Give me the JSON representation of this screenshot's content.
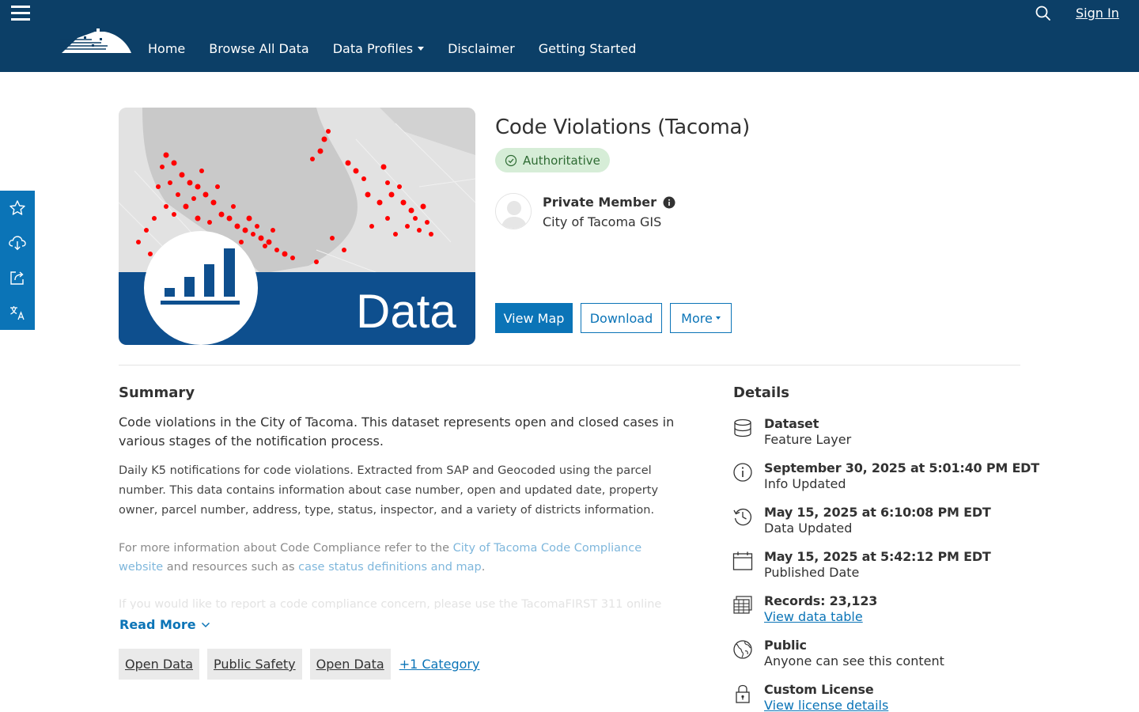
{
  "header": {
    "nav": [
      {
        "label": "Home"
      },
      {
        "label": "Browse All Data"
      },
      {
        "label": "Data Profiles"
      },
      {
        "label": "Disclaimer"
      },
      {
        "label": "Getting Started"
      }
    ],
    "sign_in": "Sign In"
  },
  "thumbnail": {
    "overlay_text": "Data"
  },
  "item": {
    "title": "Code Violations (Tacoma)",
    "badge": "Authoritative",
    "owner_name": "Private Member",
    "owner_org": "City of Tacoma GIS",
    "buttons": {
      "view_map": "View Map",
      "download": "Download",
      "more": "More"
    }
  },
  "summary": {
    "heading": "Summary",
    "lead": "Code violations in the City of Tacoma. This dataset represents open and closed cases in various stages of the notification process.",
    "desc_1": "Daily K5 notifications for code violations.  Extracted from SAP and Geocoded using the parcel number. This data contains information about case number, open and updated date, property owner, parcel number, address, type, status, inspector, and a variety of districts information.",
    "desc_2_prefix": "For more information about Code Compliance refer to the ",
    "desc_2_link1": "City of Tacoma Code Compliance website",
    "desc_2_mid": " and resources such as ",
    "desc_2_link2": "case status definitions and map",
    "desc_2_suffix": ".",
    "desc_3": "If you would like to report a code compliance concern, please use the TacomaFIRST 311 online",
    "read_more": "Read More",
    "tags": [
      "Open Data",
      "Public Safety",
      "Open Data"
    ],
    "more_categories": "+1 Category"
  },
  "details": {
    "heading": "Details",
    "items": [
      {
        "icon": "database-icon",
        "title": "Dataset",
        "sub": "Feature Layer"
      },
      {
        "icon": "info-icon",
        "title": "September 30, 2025 at 5:01:40 PM EDT",
        "sub": "Info Updated"
      },
      {
        "icon": "history-icon",
        "title": "May 15, 2025 at 6:10:08 PM EDT",
        "sub": "Data Updated"
      },
      {
        "icon": "calendar-icon",
        "title": "May 15, 2025 at 5:42:12 PM EDT",
        "sub": "Published Date"
      },
      {
        "icon": "table-icon",
        "title": "Records: 23,123",
        "link": "View data table"
      },
      {
        "icon": "globe-icon",
        "title": "Public",
        "sub": "Anyone can see this content"
      },
      {
        "icon": "lock-icon",
        "title": "Custom License",
        "link": "View license details"
      }
    ]
  },
  "colors": {
    "header_bg": "#0c3f67",
    "accent": "#0b74b7",
    "badge_bg": "#d6edd7",
    "badge_text": "#2e6b33"
  }
}
